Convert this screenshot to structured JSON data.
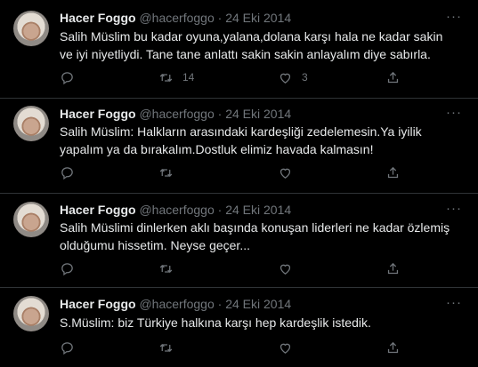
{
  "tweets": [
    {
      "name": "Hacer Foggo",
      "handle": "@hacerfoggo",
      "sep": "·",
      "date": "24 Eki 2014",
      "text": "Salih Müslim bu kadar oyuna,yalana,dolana karşı hala ne kadar sakin ve iyi niyetliydi. Tane tane anlattı sakin sakin anlayalım diye sabırla.",
      "retweets": "14",
      "likes": "3"
    },
    {
      "name": "Hacer Foggo",
      "handle": "@hacerfoggo",
      "sep": "·",
      "date": "24 Eki 2014",
      "text": "Salih Müslim: Halkların arasındaki kardeşliği zedelemesin.Ya iyilik yapalım ya da bırakalım.Dostluk elimiz havada kalmasın!",
      "retweets": "",
      "likes": ""
    },
    {
      "name": "Hacer Foggo",
      "handle": "@hacerfoggo",
      "sep": "·",
      "date": "24 Eki 2014",
      "text": "Salih Müslimi dinlerken aklı başında konuşan liderleri ne kadar özlemiş olduğumu hissetim. Neyse geçer...",
      "retweets": "",
      "likes": ""
    },
    {
      "name": "Hacer Foggo",
      "handle": "@hacerfoggo",
      "sep": "·",
      "date": "24 Eki 2014",
      "text": "S.Müslim: biz Türkiye halkına karşı hep kardeşlik istedik.",
      "retweets": "",
      "likes": ""
    }
  ],
  "colors": {
    "background": "#000000",
    "text": "#e7e9ea",
    "muted": "#71767b",
    "divider": "#2f3336"
  },
  "icons": [
    "avatar",
    "more-icon",
    "reply-icon",
    "retweet-icon",
    "like-icon",
    "share-icon"
  ]
}
